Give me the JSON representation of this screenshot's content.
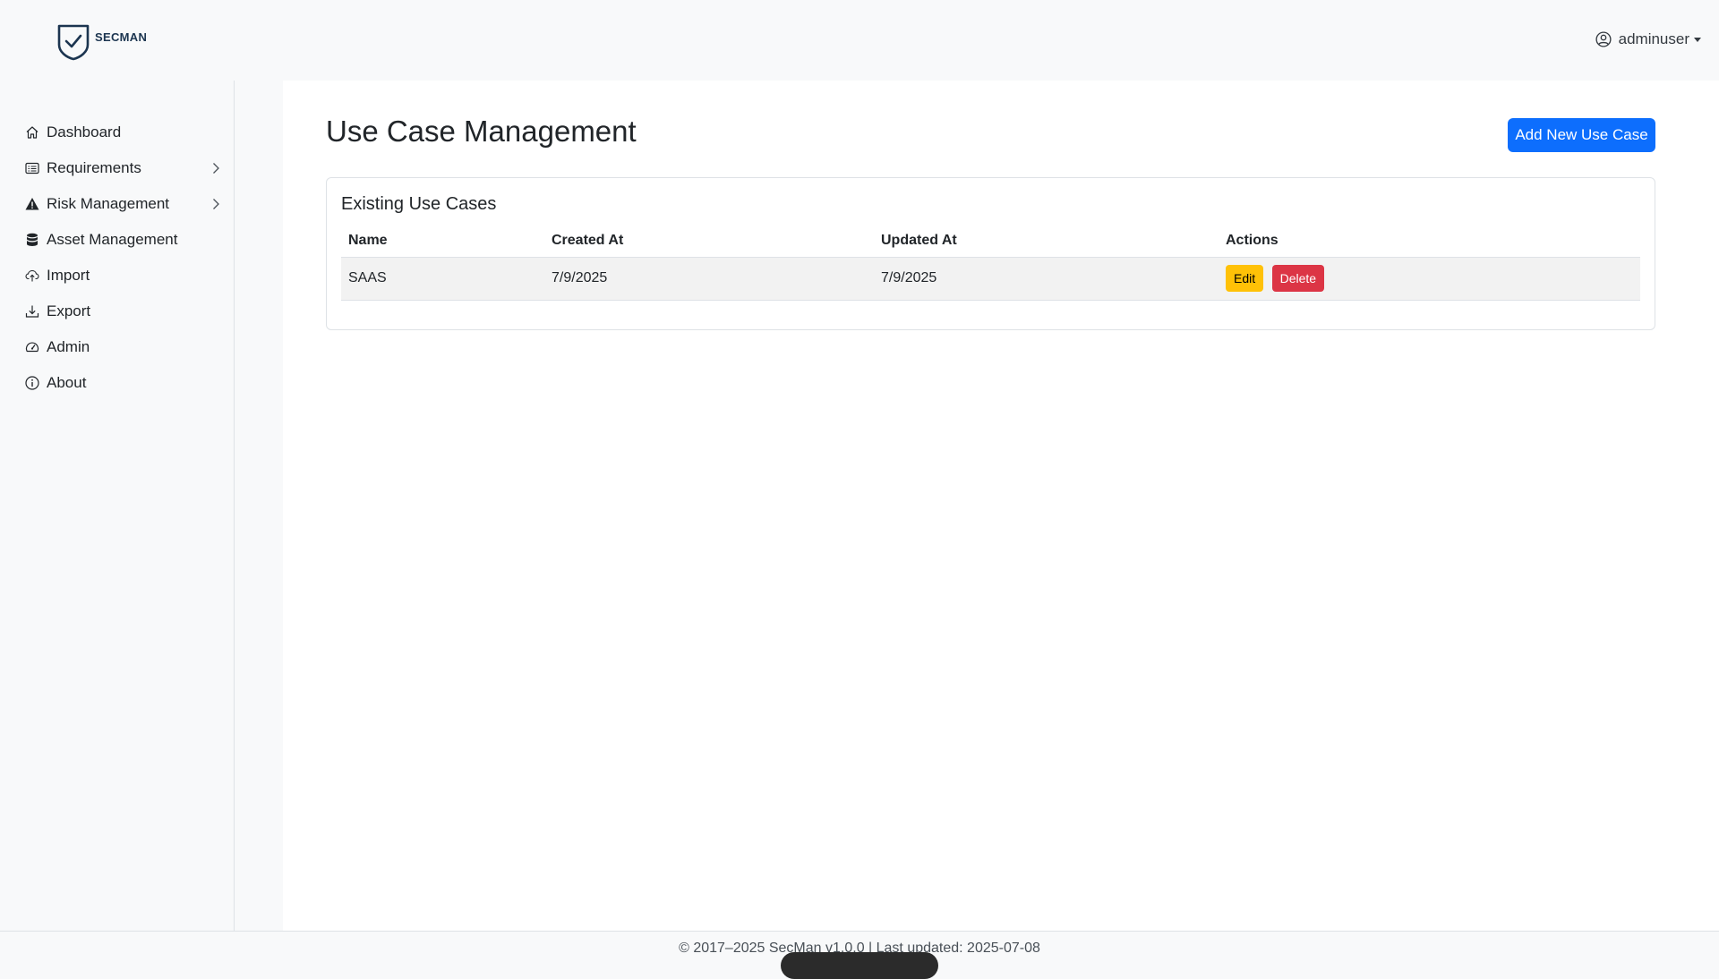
{
  "header": {
    "brand": "SECMAN",
    "user": "adminuser"
  },
  "sidebar": {
    "items": [
      {
        "label": "Dashboard",
        "icon": "home-icon"
      },
      {
        "label": "Requirements",
        "icon": "list-card-icon",
        "expandable": true
      },
      {
        "label": "Risk Management",
        "icon": "warning-icon",
        "expandable": true
      },
      {
        "label": "Asset Management",
        "icon": "database-icon"
      },
      {
        "label": "Import",
        "icon": "cloud-upload-icon"
      },
      {
        "label": "Export",
        "icon": "download-icon"
      },
      {
        "label": "Admin",
        "icon": "speedometer-icon"
      },
      {
        "label": "About",
        "icon": "info-icon"
      }
    ]
  },
  "main": {
    "title": "Use Case Management",
    "add_button": "Add New Use Case",
    "card_title": "Existing Use Cases",
    "table": {
      "headers": [
        "Name",
        "Created At",
        "Updated At",
        "Actions"
      ],
      "rows": [
        {
          "name": "SAAS",
          "created": "7/9/2025",
          "updated": "7/9/2025"
        }
      ],
      "edit_label": "Edit",
      "delete_label": "Delete"
    }
  },
  "footer": {
    "text": "© 2017–2025 SecMan v1.0.0 | Last updated: 2025-07-08"
  },
  "colors": {
    "primary": "#0d6efd",
    "warning": "#ffc107",
    "danger": "#dc3545"
  }
}
